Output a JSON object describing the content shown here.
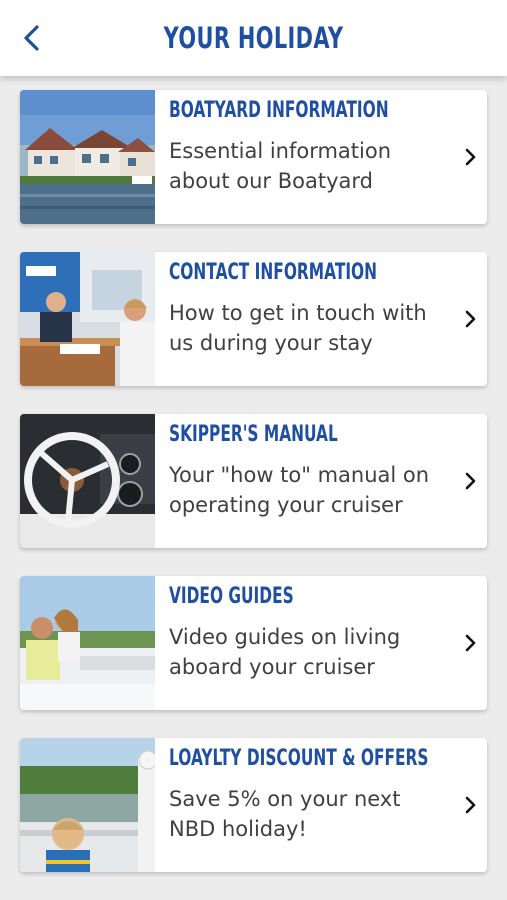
{
  "header": {
    "title": "YOUR  HOLIDAY",
    "back_icon": "chevron-left-icon"
  },
  "accent_color": "#1f4fa3",
  "cards": [
    {
      "title": "BOATYARD INFORMATION",
      "line1": "Essential information",
      "line2": "about our Boatyard"
    },
    {
      "title": "CONTACT INFORMATION",
      "line1": "How to get in touch with",
      "line2": "us during your stay"
    },
    {
      "title": "SKIPPER'S MANUAL",
      "line1": "Your \"how to\" manual on",
      "line2": "operating your cruiser"
    },
    {
      "title": "VIDEO GUIDES",
      "line1": "Video guides on living",
      "line2": "aboard your cruiser"
    },
    {
      "title": "LOAYLTY DISCOUNT & OFFERS",
      "line1": "Save 5% on your next",
      "line2": "NBD holiday!"
    }
  ]
}
